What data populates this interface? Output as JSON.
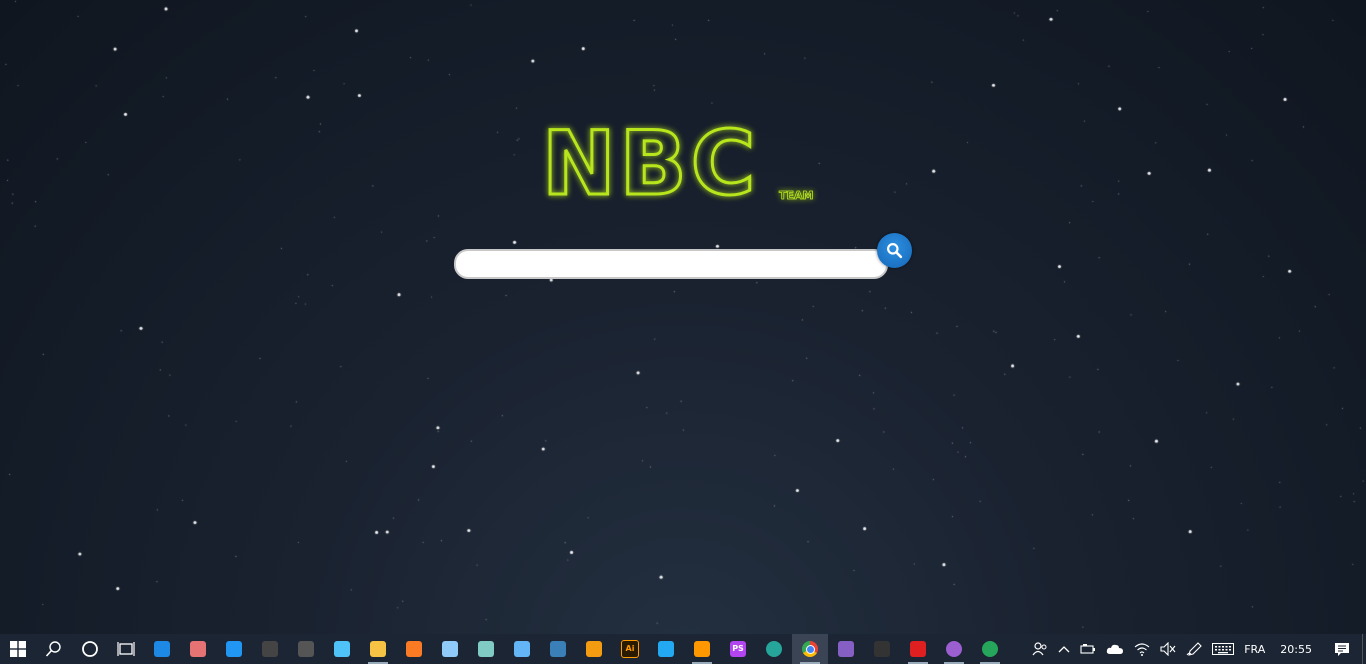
{
  "logo": {
    "text": "NBC",
    "subtext": "TEAM",
    "color": "#b8e61a"
  },
  "search": {
    "value": "",
    "placeholder": "",
    "button_icon": "search-icon",
    "button_color": "#1a6fc0"
  },
  "taskbar": {
    "start_icon": "windows-start-icon",
    "pinned": [
      {
        "id": "search",
        "icon": "search-icon"
      },
      {
        "id": "cortana",
        "icon": "cortana-circle-icon"
      },
      {
        "id": "task-view",
        "icon": "task-view-icon"
      },
      {
        "id": "store",
        "icon": "store-icon",
        "color": "#1e88e5"
      },
      {
        "id": "paint",
        "icon": "paint-icon",
        "color": "#e57373"
      },
      {
        "id": "app-diamond",
        "icon": "diamond-app-icon",
        "color": "#2196f3"
      },
      {
        "id": "calculator",
        "icon": "calculator-icon",
        "color": "#444444"
      },
      {
        "id": "remote",
        "icon": "remote-icon",
        "color": "#555555"
      },
      {
        "id": "app-id",
        "icon": "id-card-icon",
        "color": "#4fc3f7"
      },
      {
        "id": "file-explorer",
        "icon": "folder-icon",
        "color": "#f6c344"
      },
      {
        "id": "xampp",
        "icon": "xampp-icon",
        "color": "#fb7a24"
      },
      {
        "id": "app-window",
        "icon": "window-app-icon",
        "color": "#90caf9"
      },
      {
        "id": "app-doc",
        "icon": "document-app-icon",
        "color": "#80cbc4"
      },
      {
        "id": "app-news",
        "icon": "news-app-icon",
        "color": "#64b5f6"
      },
      {
        "id": "mysql-workbench",
        "icon": "workbench-icon",
        "color": "#3a7fb8"
      },
      {
        "id": "fl-studio",
        "icon": "fl-studio-icon",
        "color": "#f39c12"
      },
      {
        "id": "illustrator",
        "icon": "illustrator-icon",
        "label": "Ai",
        "color": "#ff9a00"
      },
      {
        "id": "vscode",
        "icon": "vscode-icon",
        "color": "#23a9f2"
      },
      {
        "id": "sublime",
        "icon": "sublime-text-icon",
        "color": "#ff9800"
      },
      {
        "id": "phpstorm",
        "icon": "phpstorm-icon",
        "label": "PS",
        "color": "#b345f1"
      },
      {
        "id": "app-globe",
        "icon": "globe-app-icon",
        "color": "#26a69a"
      },
      {
        "id": "chrome",
        "icon": "chrome-icon",
        "color": "#4285f4"
      },
      {
        "id": "visual-studio",
        "icon": "visual-studio-icon",
        "color": "#865fc5"
      },
      {
        "id": "terminal",
        "icon": "terminal-icon",
        "color": "#333333"
      },
      {
        "id": "acrobat",
        "icon": "acrobat-icon",
        "color": "#e02020"
      },
      {
        "id": "app-purple",
        "icon": "purple-app-icon",
        "color": "#9c5fd0"
      },
      {
        "id": "app-green",
        "icon": "green-app-icon",
        "color": "#26a65b"
      }
    ],
    "tray": {
      "people_icon": "people-icon",
      "chevron_icon": "chevron-up-icon",
      "battery_icon": "battery-icon",
      "onedrive_icon": "cloud-icon",
      "wifi_icon": "wifi-icon",
      "volume_icon": "volume-muted-icon",
      "pen_icon": "pen-icon",
      "keyboard_icon": "keyboard-icon",
      "language": "FRA",
      "time": "20:55",
      "notification_icon": "notification-icon"
    }
  }
}
